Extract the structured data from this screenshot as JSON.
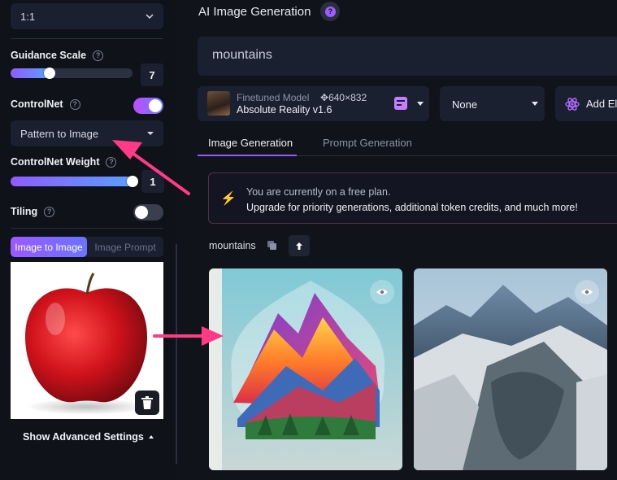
{
  "left_panel": {
    "aspect_ratio": "1:1",
    "guidance_scale": {
      "label": "Guidance Scale",
      "value": "7",
      "level": 0.3
    },
    "controlnet": {
      "label": "ControlNet",
      "enabled": true
    },
    "controlnet_mode": "Pattern to Image",
    "controlnet_weight": {
      "label": "ControlNet Weight",
      "value": "1",
      "level": 1.0
    },
    "tiling": {
      "label": "Tiling",
      "enabled": false
    },
    "mode_tabs": [
      "Image to Image",
      "Image Prompt"
    ],
    "advanced_label": "Show Advanced Settings"
  },
  "header": {
    "title": "AI Image Generation"
  },
  "prompt": {
    "value": "mountains"
  },
  "model": {
    "subtitle": "Finetuned Model",
    "dimensions": "640×832",
    "name": "Absolute Reality v1.6"
  },
  "style": {
    "value": "None"
  },
  "add_element": {
    "label": "Add El"
  },
  "tabs": [
    "Image Generation",
    "Prompt Generation"
  ],
  "notice": {
    "line1": "You are currently on a free plan.",
    "line2": "Upgrade for priority generations, additional token credits, and much more!"
  },
  "generation": {
    "prompt": "mountains"
  },
  "colors": {
    "accent": "#8f5cff",
    "annotation": "#ff3a86",
    "notice_border": "#5a2d47"
  },
  "icons": [
    "chevron-down-icon",
    "help-icon",
    "trash-icon",
    "eye-icon",
    "copy-icon",
    "arrow-up-icon",
    "bolt-icon",
    "atom-icon",
    "prompt-icon"
  ]
}
